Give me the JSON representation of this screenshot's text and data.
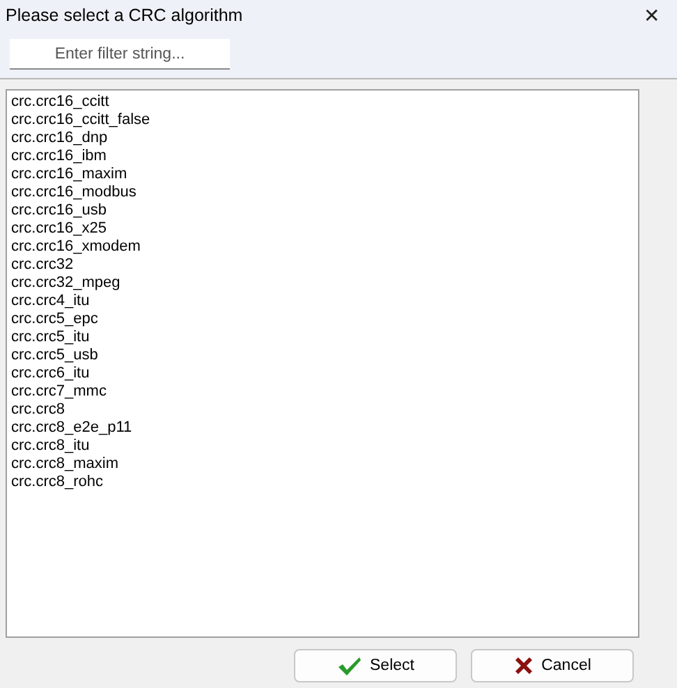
{
  "window": {
    "title": "Please select a CRC algorithm",
    "close": "✕"
  },
  "filter": {
    "placeholder": "Enter filter string..."
  },
  "items": [
    {
      "label": "crc.crc16_ccitt",
      "selected": false
    },
    {
      "label": "crc.crc16_ccitt_false",
      "selected": false
    },
    {
      "label": "crc.crc16_dnp",
      "selected": false
    },
    {
      "label": "crc.crc16_ibm",
      "selected": false
    },
    {
      "label": "crc.crc16_maxim",
      "selected": false
    },
    {
      "label": "crc.crc16_modbus",
      "selected": false
    },
    {
      "label": "crc.crc16_usb",
      "selected": false
    },
    {
      "label": "crc.crc16_x25",
      "selected": false
    },
    {
      "label": "crc.crc16_xmodem",
      "selected": false
    },
    {
      "label": "crc.crc32",
      "selected": false
    },
    {
      "label": "crc.crc32_mpeg",
      "selected": false
    },
    {
      "label": "crc.crc4_itu",
      "selected": false
    },
    {
      "label": "crc.crc5_epc",
      "selected": false
    },
    {
      "label": "crc.crc5_itu",
      "selected": false
    },
    {
      "label": "crc.crc5_usb",
      "selected": false
    },
    {
      "label": "crc.crc6_itu",
      "selected": false
    },
    {
      "label": "crc.crc7_mmc",
      "selected": false
    },
    {
      "label": "crc.crc8",
      "selected": false
    },
    {
      "label": "crc.crc8_e2e_p11",
      "selected": false
    },
    {
      "label": "crc.crc8_itu",
      "selected": false
    },
    {
      "label": "crc.crc8_maxim",
      "selected": false
    },
    {
      "label": "crc.crc8_rohc",
      "selected": false
    }
  ],
  "buttons": [
    {
      "kind": "ok",
      "label": "Select"
    },
    {
      "kind": "cancel",
      "label": "Cancel"
    }
  ]
}
